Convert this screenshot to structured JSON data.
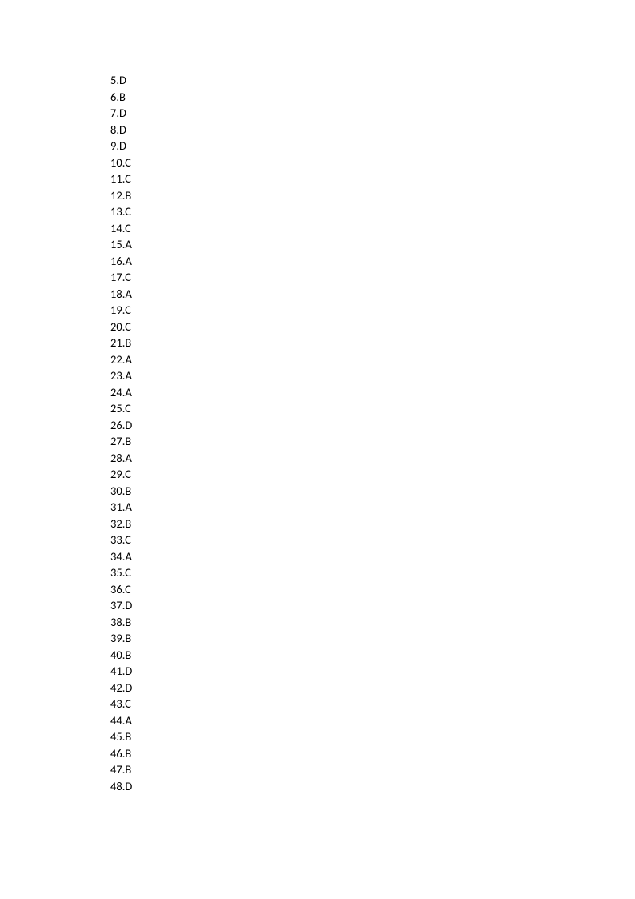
{
  "answers": [
    {
      "num": "5",
      "letter": "D"
    },
    {
      "num": "6",
      "letter": "B"
    },
    {
      "num": "7",
      "letter": "D"
    },
    {
      "num": "8",
      "letter": "D"
    },
    {
      "num": "9",
      "letter": "D"
    },
    {
      "num": "10",
      "letter": "C"
    },
    {
      "num": "11",
      "letter": "C"
    },
    {
      "num": "12",
      "letter": "B"
    },
    {
      "num": "13",
      "letter": "C"
    },
    {
      "num": "14",
      "letter": "C"
    },
    {
      "num": "15",
      "letter": "A"
    },
    {
      "num": "16",
      "letter": "A"
    },
    {
      "num": "17",
      "letter": "C"
    },
    {
      "num": "18",
      "letter": "A"
    },
    {
      "num": "19",
      "letter": "C"
    },
    {
      "num": "20",
      "letter": "C"
    },
    {
      "num": "21",
      "letter": "B"
    },
    {
      "num": "22",
      "letter": "A"
    },
    {
      "num": "23",
      "letter": "A"
    },
    {
      "num": "24",
      "letter": "A"
    },
    {
      "num": "25",
      "letter": "C"
    },
    {
      "num": "26",
      "letter": "D"
    },
    {
      "num": "27",
      "letter": "B"
    },
    {
      "num": "28",
      "letter": "A"
    },
    {
      "num": "29",
      "letter": "C"
    },
    {
      "num": "30",
      "letter": "B"
    },
    {
      "num": "31",
      "letter": "A"
    },
    {
      "num": "32",
      "letter": "B"
    },
    {
      "num": "33",
      "letter": "C"
    },
    {
      "num": "34",
      "letter": "A"
    },
    {
      "num": "35",
      "letter": "C"
    },
    {
      "num": "36",
      "letter": "C"
    },
    {
      "num": "37",
      "letter": "D"
    },
    {
      "num": "38",
      "letter": "B"
    },
    {
      "num": "39",
      "letter": "B"
    },
    {
      "num": "40",
      "letter": "B"
    },
    {
      "num": "41",
      "letter": "D"
    },
    {
      "num": "42",
      "letter": "D"
    },
    {
      "num": "43",
      "letter": "C"
    },
    {
      "num": "44",
      "letter": "A"
    },
    {
      "num": "45",
      "letter": "B"
    },
    {
      "num": "46",
      "letter": "B"
    },
    {
      "num": "47",
      "letter": "B"
    },
    {
      "num": "48",
      "letter": "D"
    }
  ]
}
